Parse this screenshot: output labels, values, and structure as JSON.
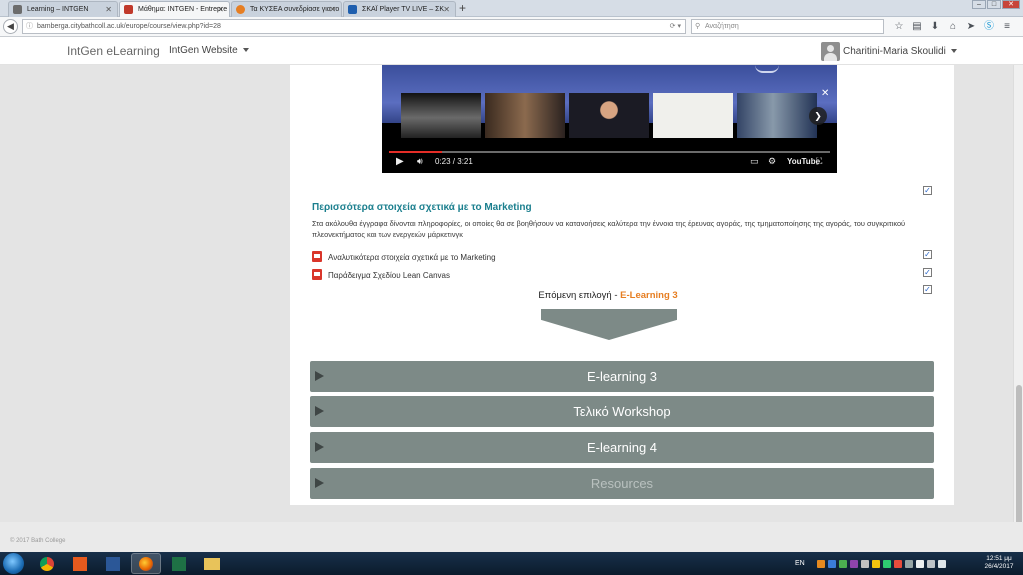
{
  "browser": {
    "tabs": [
      {
        "title": "Learning – INTGEN",
        "favicon_color": "#6c6c6c"
      },
      {
        "title": "Μάθημα: INTGEN - Entrepre",
        "favicon_color": "#c0392b"
      },
      {
        "title": "Τα ΚΥΣΕΑ συνεδρίασε για το",
        "favicon_color": "#e67e22"
      },
      {
        "title": "ΣΚΑΪ Player TV LIVE – ΣΚ",
        "favicon_color": "#1f5fae"
      }
    ],
    "url": "bamberga.citybathcoll.ac.uk/europe/course/view.php?id=28",
    "search_placeholder": "Αναζήτηση"
  },
  "header": {
    "brand": "IntGen eLearning",
    "site_link": "IntGen Website",
    "user_name": "Charitini-Maria Skoulidi"
  },
  "video": {
    "time": "0:23 / 3:21",
    "progress": 0.12,
    "logo": "YouTube"
  },
  "section": {
    "title": "Περισσότερα στοιχεία σχετικά με το Marketing",
    "description": "Στα ακόλουθα έγγραφα δίνονται πληροφορίες, οι οποίες θα σε βοηθήσουν να κατανοήσεις καλύτερα την έννοια της έρευνας αγοράς, της τμηματοποίησης της αγοράς, του συγκριτικού πλεονεκτήματος και των ενεργειών μάρκετινγκ",
    "files": [
      {
        "name": "Αναλυτικότερα στοιχεία σχετικά με το Marketing"
      },
      {
        "name": "Παράδειγμα Σχεδίου Lean Canvas"
      }
    ],
    "next_prefix": "Επόμενη επιλογή -",
    "next_target": "E-Learning 3"
  },
  "sections": [
    {
      "label": "E-learning 3"
    },
    {
      "label": "Τελικό Workshop"
    },
    {
      "label": "E-learning 4"
    },
    {
      "label": "Resources"
    }
  ],
  "footer": {
    "copyright": "© 2017 Bath College"
  },
  "taskbar": {
    "language": "EN",
    "time": "12:51 μμ",
    "date": "26/4/2017"
  }
}
